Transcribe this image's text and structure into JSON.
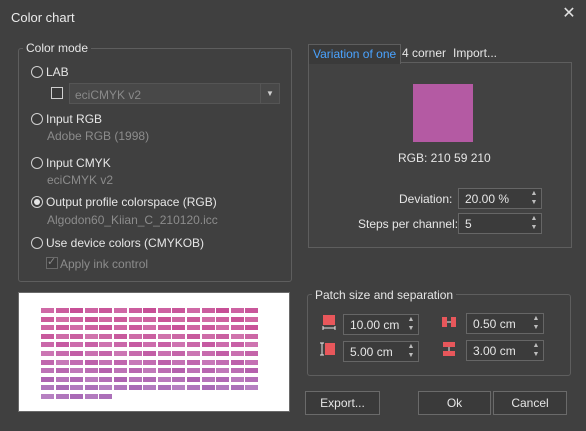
{
  "window": {
    "title": "Color chart",
    "close_icon": "close-icon"
  },
  "color_mode": {
    "group_label": "Color mode",
    "lab": {
      "label": "LAB",
      "profile_value": "eciCMYK v2"
    },
    "input_rgb": {
      "label": "Input RGB",
      "profile": "Adobe RGB (1998)"
    },
    "input_cmyk": {
      "label": "Input CMYK",
      "profile": "eciCMYK v2"
    },
    "output_profile": {
      "label": "Output profile colorspace (RGB)",
      "profile": "Algodon60_Kiian_C_210120.icc"
    },
    "device": {
      "label": "Use device colors (CMYKOB)",
      "apply_ink_label": "Apply ink control"
    },
    "selected": "output_profile"
  },
  "preview": {
    "row_colors": [
      "#c74f96",
      "#ca5497",
      "#c95298",
      "#c85a9d",
      "#c65aa2",
      "#c25ea6",
      "#bd60ab",
      "#b561ad",
      "#ae63b1",
      "#a96ab6",
      "#a96ab6"
    ],
    "last_row_count": 5
  },
  "tabs": [
    {
      "label": "Variation of one",
      "active": true
    },
    {
      "label": "4 corner",
      "active": false
    },
    {
      "label": "Import...",
      "active": false
    }
  ],
  "variation": {
    "swatch_color": "#d23bd2",
    "rgb_label": "RGB: 210 59 210",
    "deviation_label": "Deviation:",
    "deviation_value": "20.00 %",
    "steps_label": "Steps per channel:",
    "steps_value": "5"
  },
  "patch": {
    "group_label": "Patch size and separation",
    "width_value": "10.00 cm",
    "height_value": "5.00 cm",
    "hsep_value": "0.50 cm",
    "vsep_value": "3.00 cm",
    "accent_color": "#e8575b"
  },
  "buttons": {
    "export": "Export...",
    "ok": "Ok",
    "cancel": "Cancel"
  }
}
